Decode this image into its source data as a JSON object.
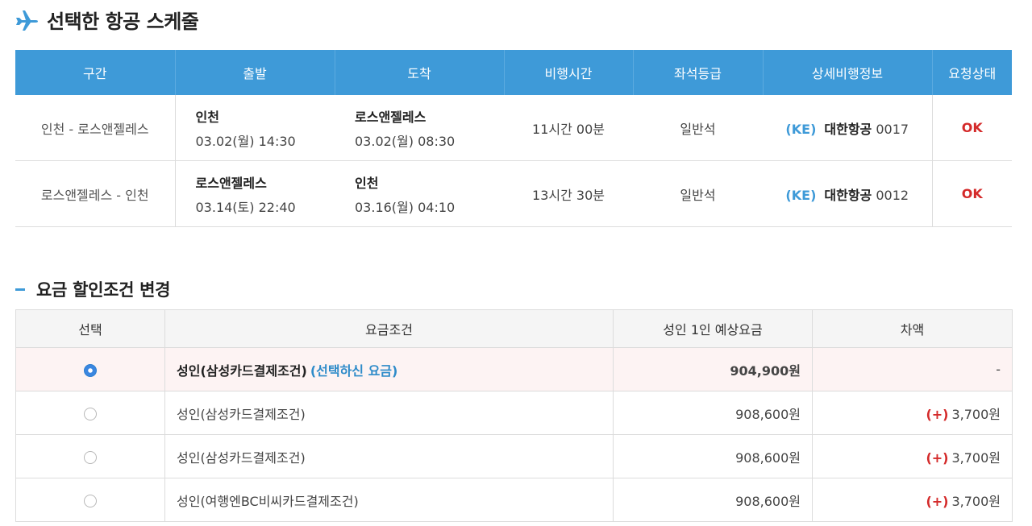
{
  "header": {
    "title": "선택한 항공 스케줄",
    "icon": "airplane-icon"
  },
  "schedule": {
    "columns": [
      "구간",
      "출발",
      "도착",
      "비행시간",
      "좌석등급",
      "상세비행정보",
      "요청상태"
    ],
    "rows": [
      {
        "route": "인천 - 로스앤젤레스",
        "dep_city": "인천",
        "dep_time": "03.02(월) 14:30",
        "arr_city": "로스앤젤레스",
        "arr_time": "03.02(월) 08:30",
        "duration": "11시간 00분",
        "seat": "일반석",
        "airline_code": "(KE)",
        "airline_name": "대한항공",
        "flight_no": "0017",
        "status": "OK"
      },
      {
        "route": "로스앤젤레스 - 인천",
        "dep_city": "로스앤젤레스",
        "dep_time": "03.14(토) 22:40",
        "arr_city": "인천",
        "arr_time": "03.16(월) 04:10",
        "duration": "13시간 30분",
        "seat": "일반석",
        "airline_code": "(KE)",
        "airline_name": "대한항공",
        "flight_no": "0012",
        "status": "OK"
      }
    ]
  },
  "fare_section": {
    "title": "요금 할인조건 변경",
    "columns": [
      "선택",
      "요금조건",
      "성인 1인 예상요금",
      "차액"
    ],
    "rows": [
      {
        "selected": true,
        "condition": "성인(삼성카드결제조건)",
        "chosen_label": "(선택하신 요금)",
        "price": "904,900원",
        "diff_prefix": "",
        "diff": "-"
      },
      {
        "selected": false,
        "condition": "성인(삼성카드결제조건)",
        "chosen_label": "",
        "price": "908,600원",
        "diff_prefix": "(+)",
        "diff": "3,700원"
      },
      {
        "selected": false,
        "condition": "성인(삼성카드결제조건)",
        "chosen_label": "",
        "price": "908,600원",
        "diff_prefix": "(+)",
        "diff": "3,700원"
      },
      {
        "selected": false,
        "condition": "성인(여행엔BC비씨카드결제조건)",
        "chosen_label": "",
        "price": "908,600원",
        "diff_prefix": "(+)",
        "diff": "3,700원"
      }
    ]
  },
  "colors": {
    "accent": "#3e9ad8",
    "ok": "#d42a2a",
    "selected_row": "#fdf3f3"
  }
}
